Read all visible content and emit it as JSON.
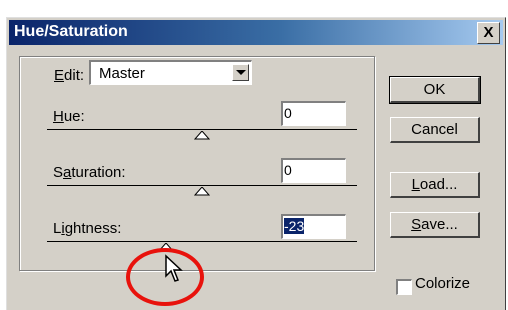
{
  "dialog": {
    "title": "Hue/Saturation",
    "close_label": "X"
  },
  "edit": {
    "label_prefix": "E",
    "label_rest": "dit:",
    "selected": "Master"
  },
  "sliders": [
    {
      "label_pre": "",
      "label_u": "H",
      "label_post": "ue:",
      "value": "0",
      "thumb_fraction": 0.5
    },
    {
      "label_pre": "S",
      "label_u": "a",
      "label_post": "turation:",
      "value": "0",
      "thumb_fraction": 0.5
    },
    {
      "label_pre": "L",
      "label_u": "i",
      "label_post": "ghtness:",
      "value": "-23",
      "thumb_fraction": 0.385
    }
  ],
  "buttons": {
    "ok": "OK",
    "cancel": "Cancel",
    "load_u": "L",
    "load_rest": "oad...",
    "save_u": "S",
    "save_rest": "ave..."
  },
  "colorize": {
    "label": "Colorize",
    "checked": false
  },
  "colors": {
    "title_start": "#0a246a",
    "title_end": "#a6caf0",
    "face": "#d4d0c8",
    "highlight_circle": "#e8120c"
  }
}
